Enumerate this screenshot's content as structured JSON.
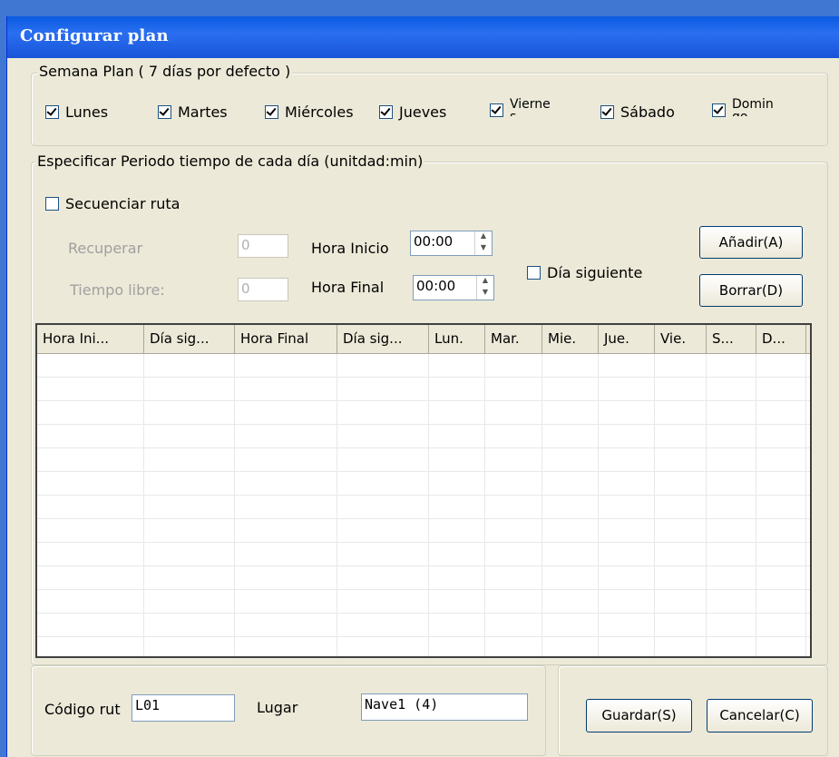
{
  "window": {
    "title": "Configurar plan"
  },
  "week": {
    "legend": "Semana Plan ( 7 días por defecto )",
    "days": [
      {
        "label": "Lunes",
        "checked": true
      },
      {
        "label": "Martes",
        "checked": true
      },
      {
        "label": "Miércoles",
        "checked": true
      },
      {
        "label": "Jueves",
        "checked": true
      },
      {
        "label": "Vierne s",
        "checked": true
      },
      {
        "label": "Sábado",
        "checked": true
      },
      {
        "label": "Domin go",
        "checked": true
      }
    ]
  },
  "period": {
    "legend": "Especificar Periodo tiempo de cada día (unitdad:min)",
    "sequence_label": "Secuenciar ruta",
    "sequence_checked": false,
    "recover_label": "Recuperar",
    "recover_value": "0",
    "free_label": "Tiempo libre:",
    "free_value": "0",
    "start_label": "Hora Inicio",
    "start_value": "00:00",
    "end_label": "Hora Final",
    "end_value": "00:00",
    "next_day_label": "Día siguiente",
    "next_day_checked": false,
    "add_label": "Añadir(A)",
    "delete_label": "Borrar(D)"
  },
  "table": {
    "columns": [
      "Hora Ini...",
      "Día sig...",
      "Hora Final",
      "Día sig...",
      "Lun.",
      "Mar.",
      "Mie.",
      "Jue.",
      "Vie.",
      "S...",
      "D..."
    ],
    "rows": []
  },
  "footer": {
    "code_label": "Código rut",
    "code_value": "L01",
    "place_label": "Lugar",
    "place_value": "Nave1 (4)",
    "save_label": "Guardar(S)",
    "cancel_label": "Cancelar(C)"
  }
}
